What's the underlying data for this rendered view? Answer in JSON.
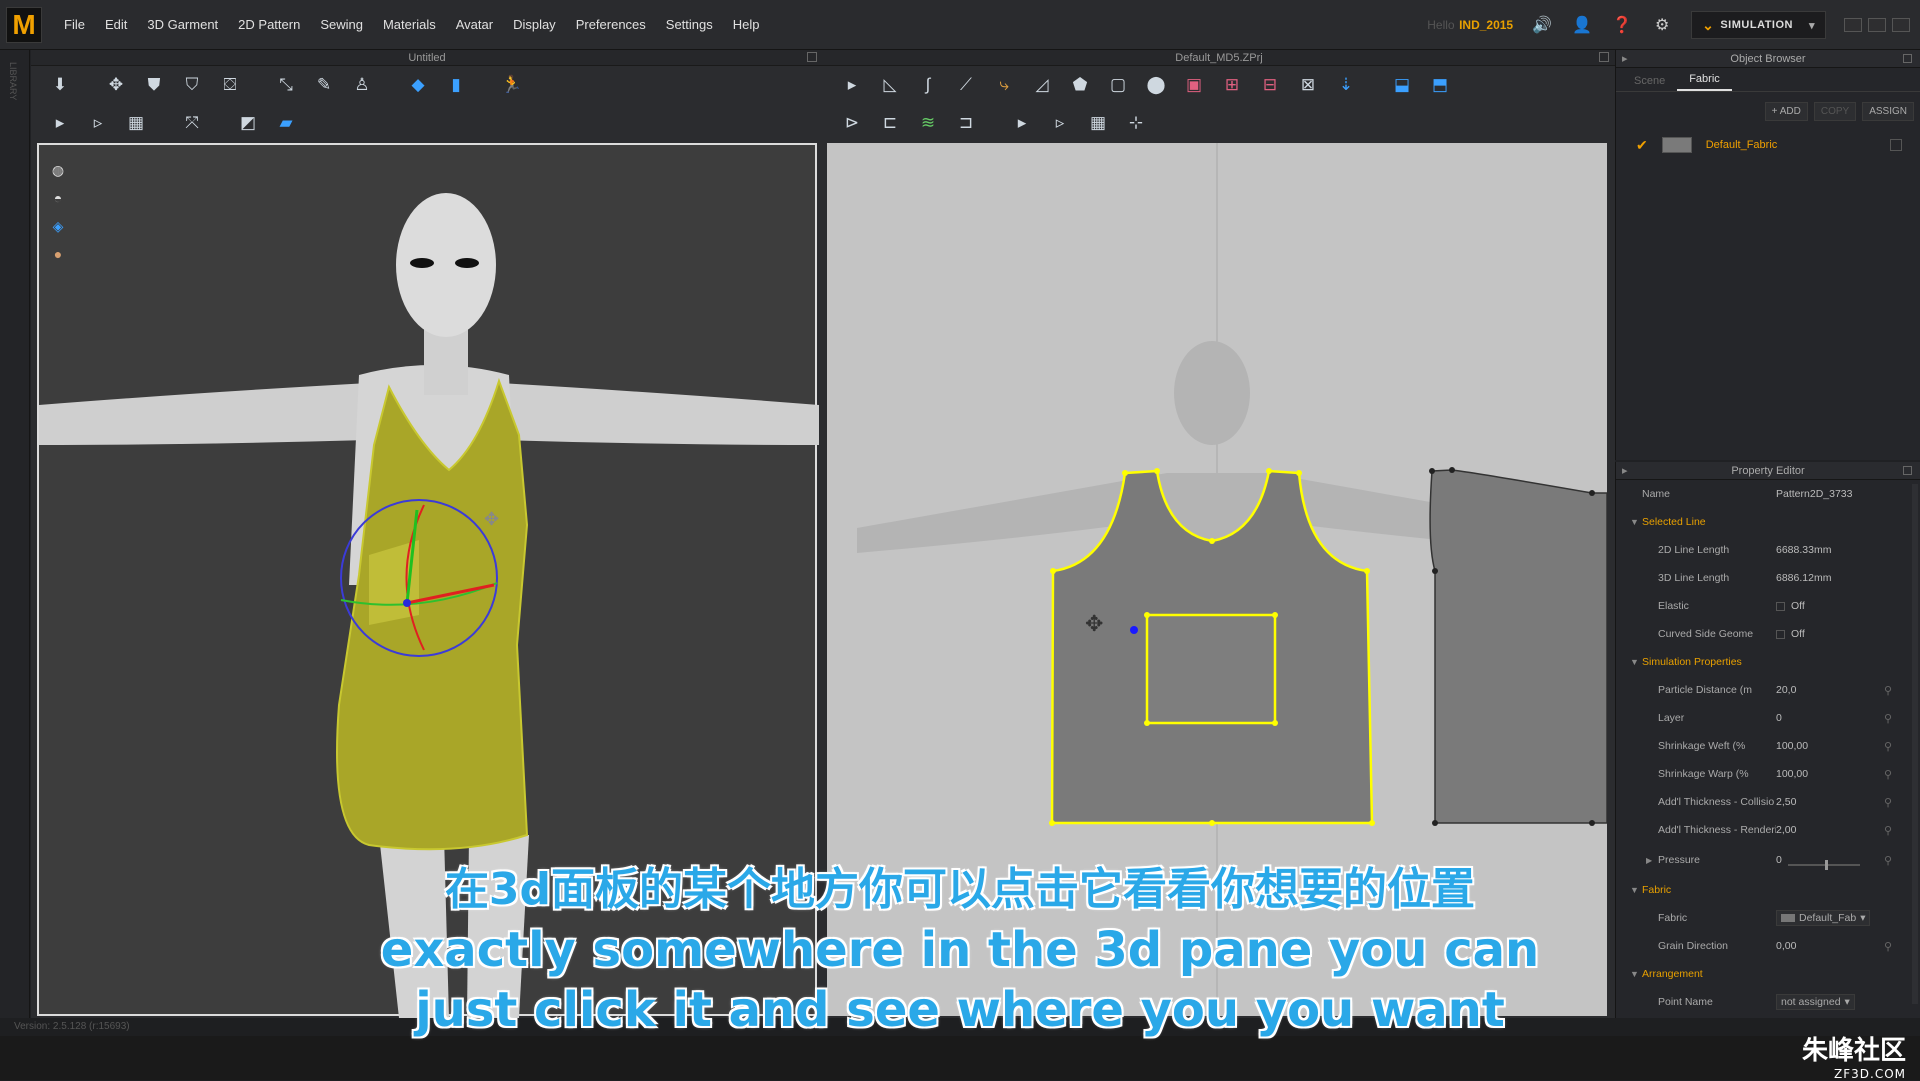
{
  "app": {
    "logo_letter": "M",
    "menu": [
      "File",
      "Edit",
      "3D Garment",
      "2D Pattern",
      "Sewing",
      "Materials",
      "Avatar",
      "Display",
      "Preferences",
      "Settings",
      "Help"
    ],
    "field_label": "Hello",
    "user_name": "IND_2015",
    "mode_label": "SIMULATION",
    "accent": "#e8a000"
  },
  "left_strip_text": "LIBRARY",
  "pane3d": {
    "title": "Untitled"
  },
  "pane2d": {
    "title": "Default_MD5.ZPrj"
  },
  "object_browser": {
    "title": "Object Browser",
    "tabs": [
      "Scene",
      "Fabric"
    ],
    "active_tab": "Fabric",
    "actions": {
      "add": "+ ADD",
      "copy": "COPY",
      "assign": "ASSIGN"
    },
    "fabric_name": "Default_Fabric"
  },
  "property_editor": {
    "title": "Property Editor",
    "name_label": "Name",
    "name_value": "Pattern2D_3733",
    "sections": {
      "selected_line": "Selected Line",
      "simulation": "Simulation Properties",
      "fabric": "Fabric",
      "arrangement": "Arrangement"
    },
    "selected_line": [
      {
        "k": "2D Line Length",
        "v": "6688.33mm"
      },
      {
        "k": "3D Line Length",
        "v": "6886.12mm"
      },
      {
        "k": "Elastic",
        "v": "Off"
      },
      {
        "k": "Curved Side Geome",
        "v": "Off"
      }
    ],
    "simulation": [
      {
        "k": "Particle Distance (m",
        "v": "20,0"
      },
      {
        "k": "Layer",
        "v": "0"
      },
      {
        "k": "Shrinkage Weft (%",
        "v": "100,00"
      },
      {
        "k": "Shrinkage Warp (%",
        "v": "100,00"
      },
      {
        "k": "Add'l Thickness - Collisio",
        "v": "2,50"
      },
      {
        "k": "Add'l Thickness - Renderi",
        "v": "2,00"
      }
    ],
    "pressure": {
      "k": "Pressure",
      "v": "0"
    },
    "fabric_rows": [
      {
        "k": "Fabric",
        "v": "Default_Fab"
      },
      {
        "k": "Grain Direction",
        "v": "0,00"
      }
    ],
    "arrangement_rows": [
      {
        "k": "Point Name",
        "v": "not assigned"
      }
    ]
  },
  "status": {
    "version": "Version: 2.5.128   (r:15693)"
  },
  "subtitles": {
    "cn": "在3d面板的某个地方你可以点击它看看你想要的位置",
    "en1": "exactly somewhere in the 3d pane you can",
    "en2": "just click it and see where you you want"
  },
  "watermark": {
    "main": "朱峰社区",
    "url": "ZF3D.COM"
  }
}
